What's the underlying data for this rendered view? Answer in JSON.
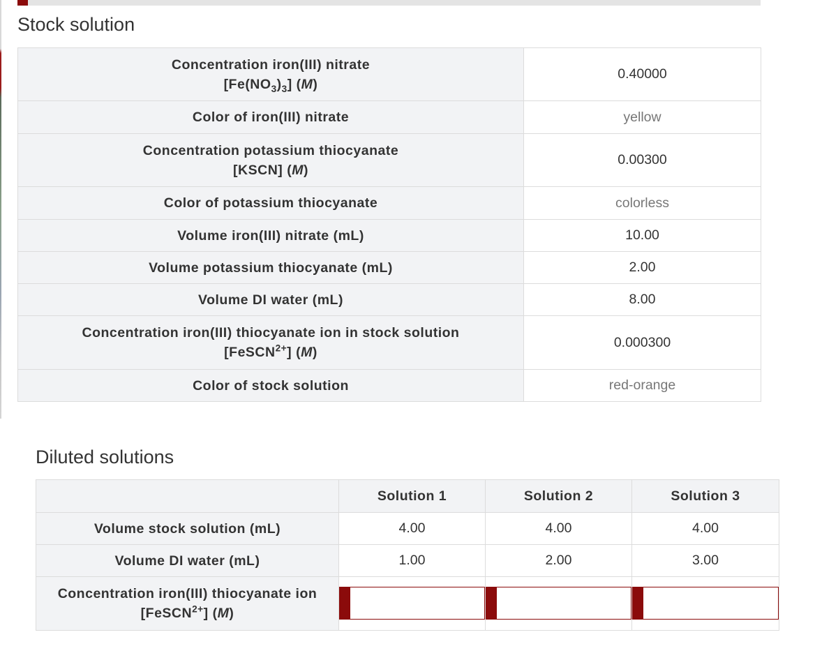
{
  "stock": {
    "title": "Stock solution",
    "rows": [
      {
        "label_line1": "Concentration iron(III) nitrate",
        "formula_prefix": "[Fe(NO",
        "formula_sub": "3",
        "formula_mid": ")",
        "formula_sub2": "3",
        "formula_suffix": "]",
        "unit_italic": "M",
        "value": "0.40000"
      },
      {
        "label": "Color of iron(III) nitrate",
        "value": "yellow"
      },
      {
        "label_line1": "Concentration potassium thiocyanate",
        "formula": "[KSCN]",
        "unit_italic": "M",
        "value": "0.00300"
      },
      {
        "label": "Color of potassium thiocyanate",
        "value": "colorless"
      },
      {
        "label": "Volume iron(III) nitrate (mL)",
        "value": "10.00"
      },
      {
        "label": "Volume potassium thiocyanate (mL)",
        "value": "2.00"
      },
      {
        "label": "Volume DI water (mL)",
        "value": "8.00"
      },
      {
        "label_line1": "Concentration iron(III) thiocyanate ion in stock solution",
        "formula_prefix": "[FeSCN",
        "formula_sup": "2+",
        "formula_suffix": "]",
        "unit_italic": "M",
        "value": "0.000300"
      },
      {
        "label": "Color of stock solution",
        "value": "red-orange"
      }
    ]
  },
  "diluted": {
    "title": "Diluted solutions",
    "columns": [
      "Solution 1",
      "Solution 2",
      "Solution 3"
    ],
    "rows": [
      {
        "label": "Volume stock solution (mL)",
        "values": [
          "4.00",
          "4.00",
          "4.00"
        ]
      },
      {
        "label": "Volume DI water (mL)",
        "values": [
          "1.00",
          "2.00",
          "3.00"
        ]
      }
    ],
    "concentration_row": {
      "label_line1": "Concentration iron(III) thiocyanate ion",
      "formula_prefix": "[FeSCN",
      "formula_sup": "2+",
      "formula_suffix": "]",
      "unit_italic": "M",
      "inputs": [
        "",
        "",
        ""
      ]
    }
  },
  "colors": {
    "accent": "#8b0b0b",
    "label_bg": "#f2f3f5",
    "border": "#dcdcdc"
  }
}
